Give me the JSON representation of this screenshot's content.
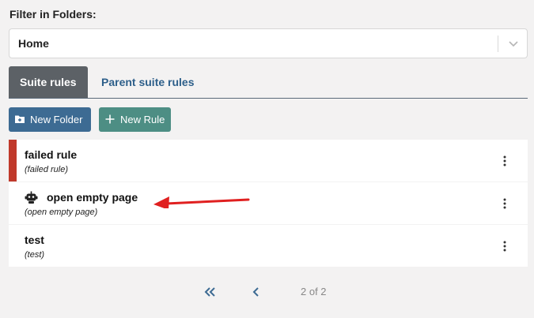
{
  "filter": {
    "label": "Filter in Folders:",
    "selected": "Home"
  },
  "tabs": [
    {
      "label": "Suite rules",
      "active": true
    },
    {
      "label": "Parent suite rules",
      "active": false
    }
  ],
  "buttons": {
    "new_folder": "New Folder",
    "new_rule": "New Rule"
  },
  "rules": [
    {
      "title": "failed rule",
      "subtitle": "(failed rule)",
      "status": "failed",
      "icon": null
    },
    {
      "title": "open empty page",
      "subtitle": "(open empty page)",
      "status": "normal",
      "icon": "robot-icon"
    },
    {
      "title": "test",
      "subtitle": "(test)",
      "status": "normal",
      "icon": null
    }
  ],
  "pagination": {
    "text": "2 of 2"
  },
  "colors": {
    "failed_accent": "#c0392b",
    "tab_active": "#5c6166",
    "new_folder_bg": "#3d6b93",
    "new_rule_bg": "#4d8e84",
    "arrow": "#e02020"
  }
}
